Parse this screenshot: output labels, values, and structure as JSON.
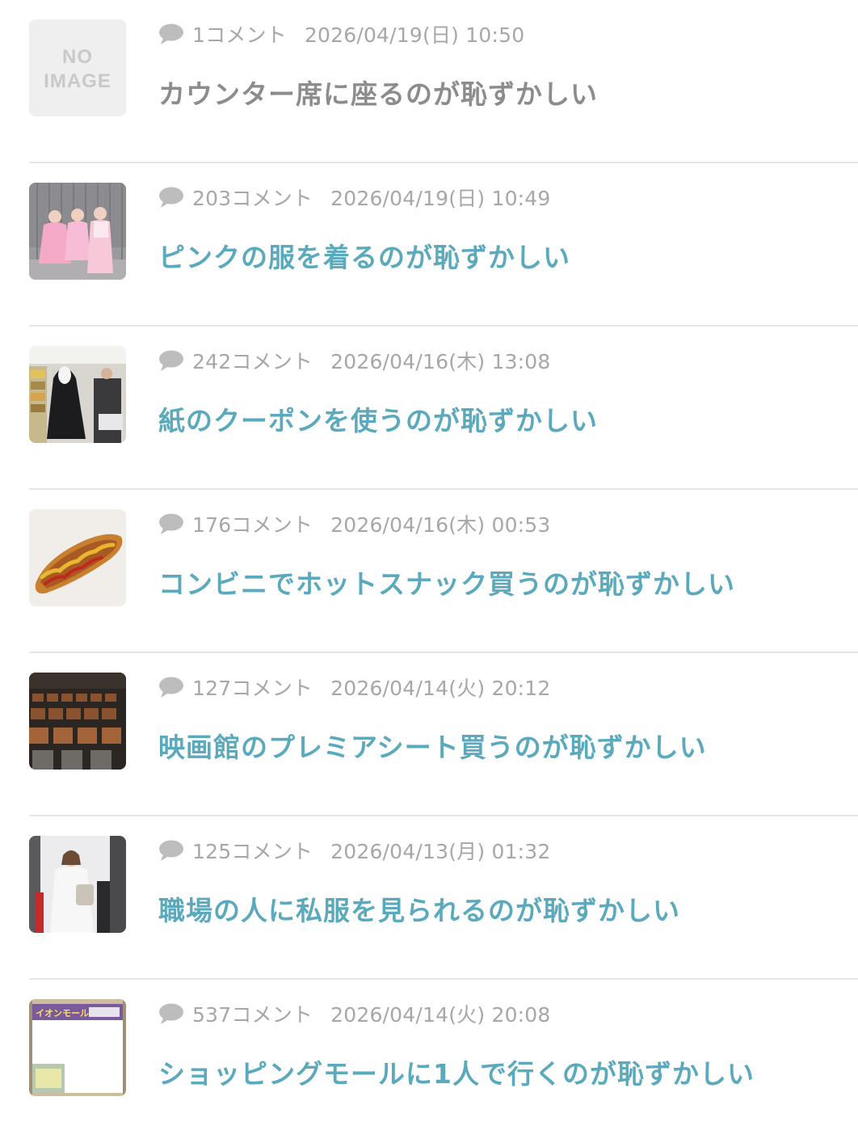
{
  "colors": {
    "title_link": "#5aa9bd",
    "title_visited": "#8c8c8c",
    "meta_text": "#a7a7a7",
    "divider": "#e6e6e6"
  },
  "articles": [
    {
      "thumbnail": "no-image-placeholder",
      "no_image_line1": "NO",
      "no_image_line2": "IMAGE",
      "comments": "1コメント",
      "date": "2026/04/19(日) 10:50",
      "title": "カウンター席に座るのが恥ずかしい",
      "visited": true
    },
    {
      "thumbnail": "pink-outfits-photo",
      "comments": "203コメント",
      "date": "2026/04/19(日) 10:49",
      "title": "ピンクの服を着るのが恥ずかしい",
      "visited": false
    },
    {
      "thumbnail": "store-costume-photo",
      "comments": "242コメント",
      "date": "2026/04/16(木) 13:08",
      "title": "紙のクーポンを使うのが恥ずかしい",
      "visited": false
    },
    {
      "thumbnail": "corn-dog-photo",
      "comments": "176コメント",
      "date": "2026/04/16(木) 00:53",
      "title": "コンビニでホットスナック買うのが恥ずかしい",
      "visited": false
    },
    {
      "thumbnail": "theater-seats-photo",
      "comments": "127コメント",
      "date": "2026/04/14(火) 20:12",
      "title": "映画館のプレミアシート買うのが恥ずかしい",
      "visited": false
    },
    {
      "thumbnail": "woman-casual-photo",
      "comments": "125コメント",
      "date": "2026/04/13(月) 01:32",
      "title": "職場の人に私服を見られるのが恥ずかしい",
      "visited": false
    },
    {
      "thumbnail": "mall-screenshot-photo",
      "mall_banner_text": "イオンモール",
      "comments": "537コメント",
      "date": "2026/04/14(火) 20:08",
      "title": "ショッピングモールに1人で行くのが恥ずかしい",
      "visited": false
    }
  ]
}
